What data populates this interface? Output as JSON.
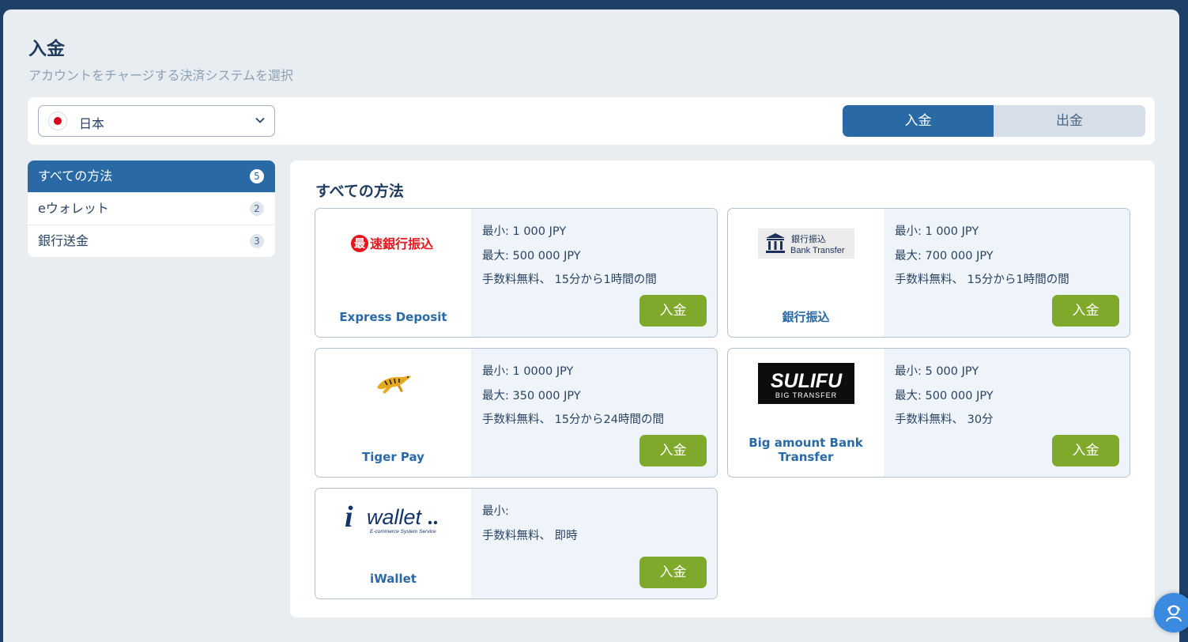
{
  "header": {
    "title": "入金",
    "subtitle": "アカウントをチャージする決済システムを選択"
  },
  "filter": {
    "country": "日本",
    "flag_icon": "japan-flag-icon",
    "deposit_label": "入金",
    "withdraw_label": "出金"
  },
  "sidebar": {
    "items": [
      {
        "label": "すべての方法",
        "count": "5"
      },
      {
        "label": "eウォレット",
        "count": "2"
      },
      {
        "label": "銀行送金",
        "count": "3"
      }
    ]
  },
  "main": {
    "title": "すべての方法",
    "cards": [
      {
        "name": "Express Deposit",
        "logo_text": "最速銀行振込",
        "min": "最小: 1 000 JPY",
        "max": "最大: 500 000 JPY",
        "fee": "手数料無料、 15分から1時間の間",
        "button": "入金"
      },
      {
        "name": "銀行振込",
        "logo_text_top": "銀行振込",
        "logo_text_bottom": "Bank Transfer",
        "min": "最小: 1 000 JPY",
        "max": "最大: 700 000 JPY",
        "fee": "手数料無料、 15分から1時間の間",
        "button": "入金"
      },
      {
        "name": "Tiger Pay",
        "min": "最小: 1 0000 JPY",
        "max": "最大: 350 000 JPY",
        "fee": "手数料無料、 15分から24時間の間",
        "button": "入金"
      },
      {
        "name": "Big amount Bank Transfer",
        "logo_text_top": "SULIFU",
        "logo_text_bottom": "BIG TRANSFER",
        "min": "最小: 5 000 JPY",
        "max": "最大: 500 000 JPY",
        "fee": "手数料無料、 30分",
        "button": "入金"
      },
      {
        "name": "iWallet",
        "logo_text": "wallet",
        "logo_subtext": "E-commerce System Service",
        "min": "最小:",
        "fee": "手数料無料、 即時",
        "button": "入金"
      }
    ]
  },
  "colors": {
    "primary": "#2869a6",
    "deposit_button": "#7ea92a",
    "header_bar": "#1e3f66"
  }
}
